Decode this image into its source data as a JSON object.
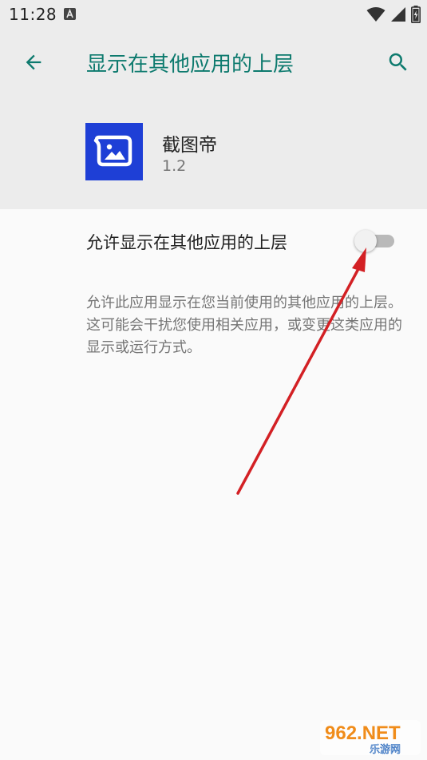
{
  "status_bar": {
    "time": "11:28",
    "notification_icon": "a-notification-icon",
    "wifi_icon": "wifi-icon",
    "signal_icon": "cell-signal-icon",
    "battery_icon": "battery-icon"
  },
  "app_bar": {
    "back_icon": "arrow-back-icon",
    "title": "显示在其他应用的上层",
    "search_icon": "search-icon"
  },
  "app_info": {
    "name": "截图帝",
    "version": "1.2",
    "icon": "screenshot-app-icon"
  },
  "permission": {
    "label": "允许显示在其他应用的上层",
    "enabled": false,
    "description": "允许此应用显示在您当前使用的其他应用的上层。这可能会干扰您使用相关应用，或变更这类应用的显示或运行方式。"
  },
  "watermark": {
    "brand": "962.NET",
    "sub": "乐游网"
  },
  "colors": {
    "accent": "#0d7a6e",
    "app_icon_bg": "#1e3fd6",
    "arrow": "#d32024"
  }
}
